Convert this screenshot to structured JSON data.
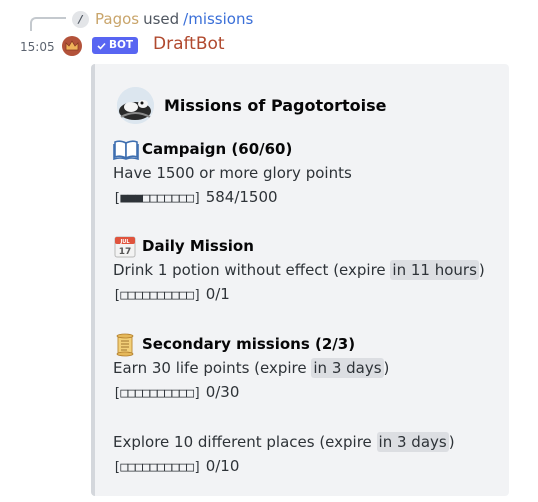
{
  "reply": {
    "user": "Pagos",
    "used_text": "used",
    "command": "/missions"
  },
  "message": {
    "timestamp": "15:05",
    "bot_tag": "BOT",
    "author": "DraftBot"
  },
  "embed": {
    "title": "Missions of Pagotortoise",
    "campaign": {
      "title": "Campaign (60/60)",
      "description": "Have 1500 or more glory points",
      "bar": "[■■■□□□□□□□]",
      "progress": "584/1500",
      "progress_fraction": 0.389
    },
    "daily": {
      "title": "Daily Mission",
      "description": "Drink 1 potion without effect (expire ",
      "expire": "in 11 hours",
      "close": ")",
      "bar": "[□□□□□□□□□□]",
      "progress": "0/1",
      "calendar_month": "JUL",
      "calendar_day": "17"
    },
    "secondary": {
      "title": "Secondary missions (2/3)",
      "missions": [
        {
          "description": "Earn 30 life points (expire ",
          "expire": "in 3 days",
          "close": ")",
          "bar": "[□□□□□□□□□□]",
          "progress": "0/30"
        },
        {
          "description": "Explore 10 different places (expire ",
          "expire": "in 3 days",
          "close": ")",
          "bar": "[□□□□□□□□□□]",
          "progress": "0/10"
        }
      ]
    }
  },
  "colors": {
    "bot_tag": "#5865f2",
    "author": "#b0492e",
    "reply_user": "#c9a56b",
    "command": "#3a6fd8",
    "embed_bg": "#f2f3f5"
  }
}
